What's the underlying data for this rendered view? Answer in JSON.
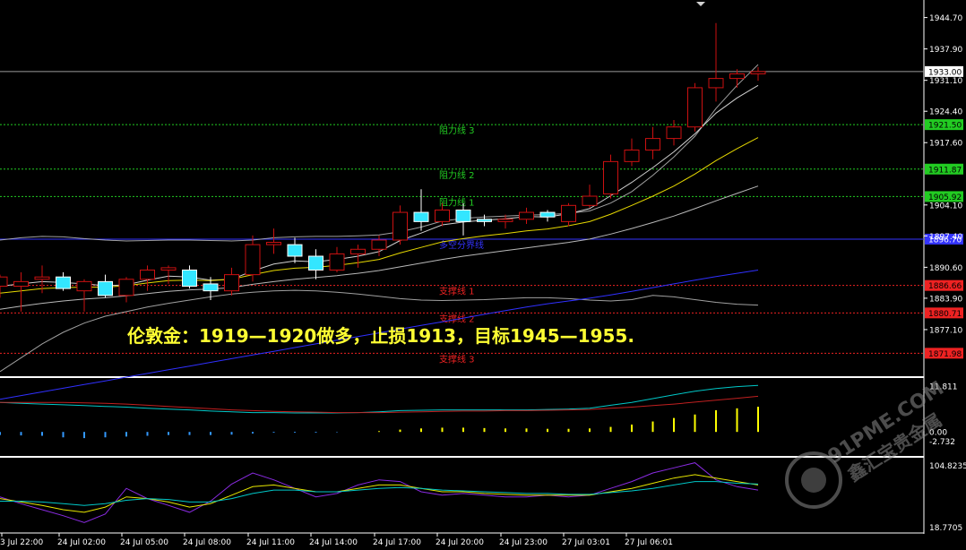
{
  "chart_data": {
    "type": "candlestick",
    "instrument_view": "XAUUSD H1",
    "headline": "伦敦金：1919—1920做多，止损1913，目标1945—1955.",
    "price_axis": {
      "range": [
        1867.0,
        1948.5
      ],
      "ticks": [
        "1944.70",
        "1937.90",
        "1931.10",
        "1924.40",
        "1917.60",
        "1904.10",
        "1897.40",
        "1890.60",
        "1883.90",
        "1877.10"
      ]
    },
    "current_price": {
      "label": "1933.00",
      "value": 1933.0
    },
    "levels": [
      {
        "label": "阻力线 3",
        "value": 1921.5,
        "tag": "1921.50",
        "color": "#22cc22"
      },
      {
        "label": "阻力线 2",
        "value": 1911.87,
        "tag": "1911.87",
        "color": "#22cc22"
      },
      {
        "label": "阻力线 1",
        "value": 1905.92,
        "tag": "1905.92",
        "color": "#22cc22"
      },
      {
        "label": "多空分界线",
        "value": 1896.7,
        "tag": "1896.70",
        "color": "#3333ff"
      },
      {
        "label": "支撑线 1",
        "value": 1886.66,
        "tag": "1886.66",
        "color": "#ee2222"
      },
      {
        "label": "支撑线 2",
        "value": 1880.71,
        "tag": "1880.71",
        "color": "#ee2222"
      },
      {
        "label": "支撑线 3",
        "value": 1871.98,
        "tag": "1871.98",
        "color": "#ee2222"
      }
    ],
    "candles": [
      {
        "o": 1886.5,
        "h": 1889.0,
        "l": 1884.0,
        "c": 1888.5
      },
      {
        "o": 1886.5,
        "h": 1889.5,
        "l": 1881.0,
        "c": 1887.5
      },
      {
        "o": 1888.0,
        "h": 1891.0,
        "l": 1885.0,
        "c": 1888.5
      },
      {
        "o": 1888.5,
        "h": 1889.5,
        "l": 1885.5,
        "c": 1886.0
      },
      {
        "o": 1885.5,
        "h": 1888.0,
        "l": 1881.0,
        "c": 1887.5
      },
      {
        "o": 1887.5,
        "h": 1889.0,
        "l": 1884.0,
        "c": 1884.5
      },
      {
        "o": 1884.5,
        "h": 1888.5,
        "l": 1883.0,
        "c": 1888.0
      },
      {
        "o": 1888.0,
        "h": 1891.0,
        "l": 1885.5,
        "c": 1890.0
      },
      {
        "o": 1890.0,
        "h": 1891.0,
        "l": 1887.0,
        "c": 1890.5
      },
      {
        "o": 1890.0,
        "h": 1891.0,
        "l": 1886.0,
        "c": 1886.5
      },
      {
        "o": 1887.0,
        "h": 1888.5,
        "l": 1883.5,
        "c": 1885.5
      },
      {
        "o": 1885.5,
        "h": 1890.5,
        "l": 1884.5,
        "c": 1889.0
      },
      {
        "o": 1889.0,
        "h": 1897.5,
        "l": 1887.5,
        "c": 1895.5
      },
      {
        "o": 1895.5,
        "h": 1899.0,
        "l": 1893.5,
        "c": 1896.0
      },
      {
        "o": 1895.5,
        "h": 1897.0,
        "l": 1891.5,
        "c": 1893.0
      },
      {
        "o": 1893.0,
        "h": 1894.5,
        "l": 1888.0,
        "c": 1890.0
      },
      {
        "o": 1890.0,
        "h": 1895.0,
        "l": 1889.5,
        "c": 1893.5
      },
      {
        "o": 1893.5,
        "h": 1895.5,
        "l": 1890.5,
        "c": 1894.5
      },
      {
        "o": 1894.5,
        "h": 1897.5,
        "l": 1893.0,
        "c": 1896.5
      },
      {
        "o": 1896.5,
        "h": 1904.0,
        "l": 1895.5,
        "c": 1902.5
      },
      {
        "o": 1902.5,
        "h": 1907.5,
        "l": 1898.5,
        "c": 1900.5
      },
      {
        "o": 1900.5,
        "h": 1904.5,
        "l": 1899.5,
        "c": 1903.0
      },
      {
        "o": 1903.0,
        "h": 1904.5,
        "l": 1897.5,
        "c": 1900.5
      },
      {
        "o": 1901.0,
        "h": 1902.0,
        "l": 1899.5,
        "c": 1900.5
      },
      {
        "o": 1900.5,
        "h": 1902.0,
        "l": 1899.0,
        "c": 1901.0
      },
      {
        "o": 1901.0,
        "h": 1903.5,
        "l": 1900.0,
        "c": 1902.5
      },
      {
        "o": 1902.5,
        "h": 1903.0,
        "l": 1900.5,
        "c": 1901.5
      },
      {
        "o": 1900.5,
        "h": 1904.5,
        "l": 1899.5,
        "c": 1904.0
      },
      {
        "o": 1904.0,
        "h": 1908.5,
        "l": 1903.5,
        "c": 1906.0
      },
      {
        "o": 1906.5,
        "h": 1915.0,
        "l": 1905.5,
        "c": 1913.5
      },
      {
        "o": 1913.5,
        "h": 1918.5,
        "l": 1912.5,
        "c": 1916.0
      },
      {
        "o": 1916.0,
        "h": 1921.0,
        "l": 1914.0,
        "c": 1918.5
      },
      {
        "o": 1918.5,
        "h": 1922.5,
        "l": 1917.0,
        "c": 1921.0
      },
      {
        "o": 1921.0,
        "h": 1930.5,
        "l": 1920.0,
        "c": 1929.5
      },
      {
        "o": 1929.5,
        "h": 1943.5,
        "l": 1926.5,
        "c": 1931.5
      },
      {
        "o": 1931.5,
        "h": 1933.5,
        "l": 1929.5,
        "c": 1932.5
      },
      {
        "o": 1932.5,
        "h": 1934.0,
        "l": 1931.0,
        "c": 1933.0
      }
    ],
    "moving_averages": [
      {
        "color": "#d0d0d0",
        "values": [
          1886.5,
          1887.0,
          1887.5,
          1887.3,
          1887.0,
          1886.6,
          1886.8,
          1887.8,
          1888.7,
          1888.5,
          1887.8,
          1888.0,
          1889.8,
          1891.3,
          1892.0,
          1891.8,
          1892.3,
          1893.0,
          1894.0,
          1896.4,
          1898.0,
          1899.8,
          1900.4,
          1900.8,
          1901.1,
          1901.6,
          1901.5,
          1902.2,
          1903.3,
          1906.1,
          1909.0,
          1912.2,
          1915.6,
          1919.5,
          1924.0,
          1927.3,
          1930.0
        ]
      },
      {
        "color": "#e6d800",
        "values": [
          1885.0,
          1885.5,
          1886.0,
          1886.2,
          1886.3,
          1886.3,
          1886.6,
          1887.2,
          1887.7,
          1887.8,
          1887.7,
          1888.0,
          1889.0,
          1889.9,
          1890.4,
          1890.6,
          1891.0,
          1891.6,
          1892.3,
          1893.7,
          1894.9,
          1896.1,
          1896.8,
          1897.4,
          1897.9,
          1898.5,
          1898.9,
          1899.6,
          1900.5,
          1902.1,
          1904.0,
          1906.0,
          1908.2,
          1910.8,
          1913.7,
          1916.3,
          1918.7
        ]
      },
      {
        "color": "#b8b8b8",
        "values": [
          1881.5,
          1882.2,
          1882.8,
          1883.3,
          1883.7,
          1884.0,
          1884.4,
          1884.9,
          1885.4,
          1885.7,
          1885.9,
          1886.2,
          1886.9,
          1887.5,
          1888.0,
          1888.4,
          1888.8,
          1889.3,
          1889.9,
          1890.7,
          1891.5,
          1892.3,
          1893.0,
          1893.6,
          1894.2,
          1894.8,
          1895.4,
          1896.0,
          1896.7,
          1897.8,
          1899.0,
          1900.3,
          1901.7,
          1903.3,
          1905.0,
          1906.6,
          1908.2
        ]
      },
      {
        "color": "#3030ff",
        "values": [
          1862.0,
          1862.8,
          1863.6,
          1864.4,
          1865.2,
          1866.0,
          1866.8,
          1867.6,
          1868.4,
          1869.2,
          1870.0,
          1870.8,
          1871.6,
          1872.4,
          1873.2,
          1874.0,
          1874.8,
          1875.6,
          1876.4,
          1877.2,
          1878.0,
          1878.8,
          1879.6,
          1880.4,
          1881.2,
          1882.0,
          1882.7,
          1883.3,
          1883.9,
          1884.6,
          1885.4,
          1886.2,
          1887.0,
          1887.8,
          1888.6,
          1889.3,
          1890.0
        ]
      }
    ],
    "band_lines": [
      {
        "color": "#c8c8c8",
        "values": [
          1896.5,
          1897.0,
          1897.3,
          1897.2,
          1896.8,
          1896.5,
          1896.3,
          1896.4,
          1896.5,
          1896.5,
          1896.4,
          1896.3,
          1896.5,
          1897.0,
          1897.2,
          1897.3,
          1897.3,
          1897.4,
          1897.6,
          1898.3,
          1899.3,
          1900.6,
          1901.2,
          1901.5,
          1901.7,
          1901.9,
          1902.0,
          1902.3,
          1902.8,
          1904.5,
          1907.0,
          1910.5,
          1914.5,
          1919.0,
          1925.0,
          1930.0,
          1934.5
        ]
      },
      {
        "color": "#c8c8c8",
        "values": [
          1868.0,
          1871.0,
          1874.0,
          1876.5,
          1878.5,
          1880.0,
          1881.0,
          1882.0,
          1882.8,
          1883.5,
          1884.2,
          1884.8,
          1885.2,
          1885.5,
          1885.6,
          1885.5,
          1885.2,
          1884.8,
          1884.3,
          1883.8,
          1883.5,
          1883.4,
          1883.5,
          1883.6,
          1883.8,
          1884.0,
          1884.0,
          1883.8,
          1883.5,
          1883.3,
          1883.6,
          1884.5,
          1884.2,
          1883.6,
          1883.0,
          1882.6,
          1882.4
        ]
      }
    ],
    "indicator1": {
      "label_top": "11.811",
      "label_zero": "0.00",
      "label_bottom": "-2.732",
      "range": [
        -2.732,
        13.0
      ],
      "histogram": [
        -0.8,
        -0.9,
        -1.0,
        -1.4,
        -1.6,
        -1.4,
        -1.2,
        -1.0,
        -0.8,
        -0.8,
        -0.8,
        -0.7,
        -0.4,
        -0.2,
        -0.2,
        -0.2,
        -0.1,
        0.0,
        0.2,
        0.6,
        0.9,
        1.1,
        1.1,
        1.0,
        0.9,
        0.9,
        0.8,
        0.8,
        0.9,
        1.3,
        1.9,
        2.7,
        3.6,
        4.5,
        5.6,
        6.1,
        6.5
      ],
      "lines": [
        {
          "color": "#00c8c8",
          "values": [
            7.6,
            7.4,
            7.2,
            7.0,
            6.8,
            6.6,
            6.4,
            6.1,
            5.9,
            5.7,
            5.4,
            5.2,
            5.0,
            5.0,
            4.9,
            4.9,
            4.9,
            5.0,
            5.2,
            5.5,
            5.6,
            5.7,
            5.7,
            5.7,
            5.7,
            5.7,
            5.8,
            5.9,
            6.1,
            6.9,
            7.6,
            8.6,
            9.6,
            10.5,
            11.2,
            11.7,
            12.0
          ]
        },
        {
          "color": "#c02020",
          "values": [
            7.6,
            7.6,
            7.6,
            7.6,
            7.5,
            7.4,
            7.2,
            6.9,
            6.6,
            6.3,
            6.0,
            5.7,
            5.5,
            5.3,
            5.2,
            5.1,
            5.0,
            5.0,
            5.0,
            5.1,
            5.2,
            5.3,
            5.4,
            5.4,
            5.5,
            5.5,
            5.6,
            5.7,
            5.8,
            6.1,
            6.4,
            6.8,
            7.2,
            7.7,
            8.2,
            8.7,
            9.2
          ]
        }
      ]
    },
    "indicator2": {
      "label_top": "104.8235",
      "label_bottom": "18.7705",
      "range": [
        18.7705,
        104.8235
      ],
      "lines": [
        {
          "color": "#8a2be2",
          "values": [
            60,
            52,
            45,
            38,
            30,
            40,
            70,
            58,
            50,
            42,
            55,
            75,
            88,
            80,
            70,
            60,
            64,
            74,
            80,
            78,
            66,
            62,
            64,
            62,
            60,
            60,
            62,
            60,
            62,
            70,
            78,
            88,
            94,
            100,
            80,
            72,
            68
          ]
        },
        {
          "color": "#e6e600",
          "values": [
            58,
            54,
            50,
            45,
            42,
            48,
            60,
            58,
            54,
            48,
            52,
            62,
            72,
            74,
            70,
            66,
            66,
            70,
            74,
            74,
            70,
            66,
            66,
            64,
            63,
            62,
            62,
            62,
            62,
            66,
            70,
            76,
            82,
            86,
            82,
            78,
            74
          ]
        },
        {
          "color": "#00c8c8",
          "values": [
            55,
            55,
            54,
            52,
            50,
            52,
            56,
            58,
            57,
            54,
            54,
            58,
            64,
            68,
            68,
            66,
            66,
            68,
            70,
            71,
            70,
            68,
            67,
            66,
            65,
            64,
            64,
            63,
            63,
            65,
            67,
            70,
            74,
            78,
            78,
            76,
            75
          ]
        }
      ]
    },
    "time_labels": [
      "3 Jul 22:00",
      "24 Jul 02:00",
      "24 Jul 05:00",
      "24 Jul 08:00",
      "24 Jul 11:00",
      "24 Jul 14:00",
      "24 Jul 17:00",
      "24 Jul 20:00",
      "24 Jul 23:00",
      "27 Jul 03:01",
      "27 Jul 06:01"
    ],
    "watermark": {
      "text": "91PME.COM",
      "subtext": "鑫汇宝贵金属"
    },
    "colors": {
      "bull_body": "#000000",
      "bull_border": "#cc1111",
      "bear_body": "#33e6ff",
      "bear_border": "#ffffff",
      "wick_bull": "#cc1111",
      "wick_bear": "#ffffff",
      "grid": "#ffffff",
      "background": "#000000"
    }
  }
}
